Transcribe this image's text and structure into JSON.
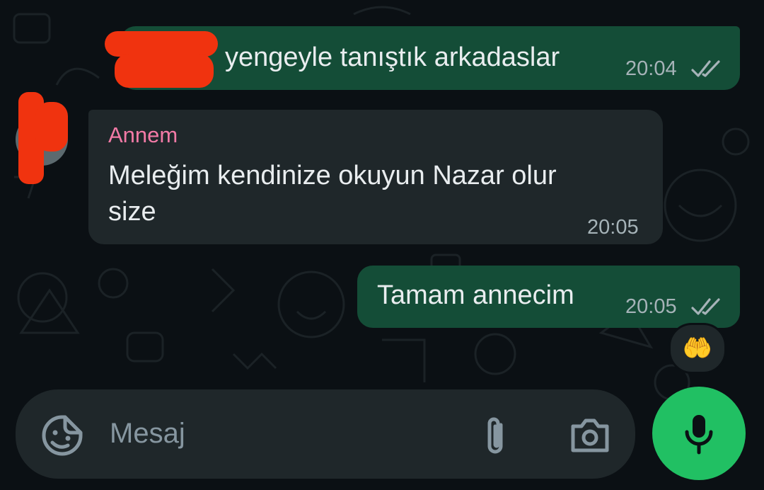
{
  "messages": [
    {
      "direction": "outgoing",
      "text": "yengeyle tanıştık arkadaslar",
      "time": "20:04",
      "status_icon": "double-check-icon"
    },
    {
      "direction": "incoming",
      "sender": "Annem",
      "text_line1": "Meleğim kendinize okuyun Nazar olur",
      "text_line2": "size",
      "time": "20:05"
    },
    {
      "direction": "outgoing",
      "text": "Tamam annecim",
      "time": "20:05",
      "status_icon": "double-check-icon",
      "reaction": "🤲"
    }
  ],
  "composer": {
    "placeholder": "Mesaj",
    "icons": [
      "sticker-icon",
      "attach-icon",
      "camera-icon",
      "mic-icon"
    ]
  },
  "colors": {
    "background": "#0b1014",
    "outgoing_bubble": "#144d37",
    "incoming_bubble": "#1f272a",
    "sender_name": "#f27aa6",
    "mic_button": "#21c063",
    "redaction": "#f0330f"
  }
}
